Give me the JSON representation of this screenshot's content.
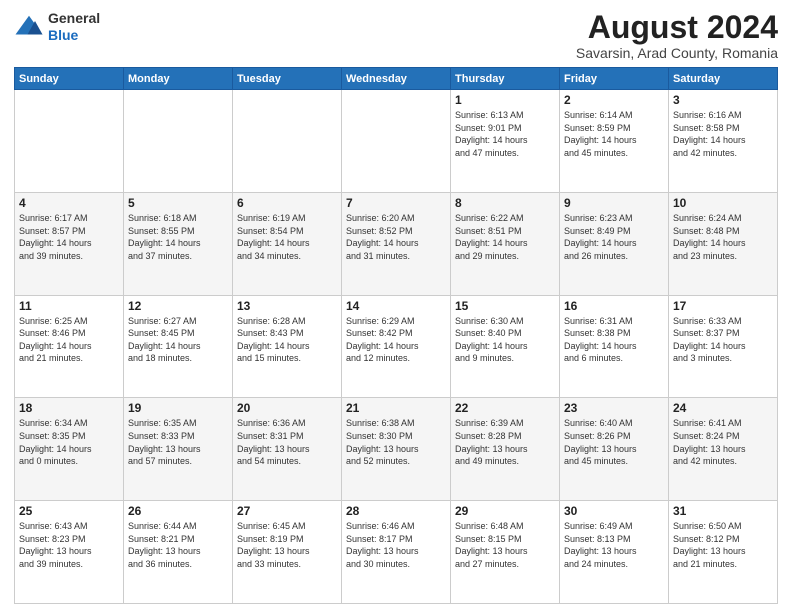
{
  "header": {
    "logo": {
      "line1": "General",
      "line2": "Blue"
    },
    "title": "August 2024",
    "location": "Savarsin, Arad County, Romania"
  },
  "weekdays": [
    "Sunday",
    "Monday",
    "Tuesday",
    "Wednesday",
    "Thursday",
    "Friday",
    "Saturday"
  ],
  "weeks": [
    [
      {
        "day": "",
        "info": ""
      },
      {
        "day": "",
        "info": ""
      },
      {
        "day": "",
        "info": ""
      },
      {
        "day": "",
        "info": ""
      },
      {
        "day": "1",
        "info": "Sunrise: 6:13 AM\nSunset: 9:01 PM\nDaylight: 14 hours\nand 47 minutes."
      },
      {
        "day": "2",
        "info": "Sunrise: 6:14 AM\nSunset: 8:59 PM\nDaylight: 14 hours\nand 45 minutes."
      },
      {
        "day": "3",
        "info": "Sunrise: 6:16 AM\nSunset: 8:58 PM\nDaylight: 14 hours\nand 42 minutes."
      }
    ],
    [
      {
        "day": "4",
        "info": "Sunrise: 6:17 AM\nSunset: 8:57 PM\nDaylight: 14 hours\nand 39 minutes."
      },
      {
        "day": "5",
        "info": "Sunrise: 6:18 AM\nSunset: 8:55 PM\nDaylight: 14 hours\nand 37 minutes."
      },
      {
        "day": "6",
        "info": "Sunrise: 6:19 AM\nSunset: 8:54 PM\nDaylight: 14 hours\nand 34 minutes."
      },
      {
        "day": "7",
        "info": "Sunrise: 6:20 AM\nSunset: 8:52 PM\nDaylight: 14 hours\nand 31 minutes."
      },
      {
        "day": "8",
        "info": "Sunrise: 6:22 AM\nSunset: 8:51 PM\nDaylight: 14 hours\nand 29 minutes."
      },
      {
        "day": "9",
        "info": "Sunrise: 6:23 AM\nSunset: 8:49 PM\nDaylight: 14 hours\nand 26 minutes."
      },
      {
        "day": "10",
        "info": "Sunrise: 6:24 AM\nSunset: 8:48 PM\nDaylight: 14 hours\nand 23 minutes."
      }
    ],
    [
      {
        "day": "11",
        "info": "Sunrise: 6:25 AM\nSunset: 8:46 PM\nDaylight: 14 hours\nand 21 minutes."
      },
      {
        "day": "12",
        "info": "Sunrise: 6:27 AM\nSunset: 8:45 PM\nDaylight: 14 hours\nand 18 minutes."
      },
      {
        "day": "13",
        "info": "Sunrise: 6:28 AM\nSunset: 8:43 PM\nDaylight: 14 hours\nand 15 minutes."
      },
      {
        "day": "14",
        "info": "Sunrise: 6:29 AM\nSunset: 8:42 PM\nDaylight: 14 hours\nand 12 minutes."
      },
      {
        "day": "15",
        "info": "Sunrise: 6:30 AM\nSunset: 8:40 PM\nDaylight: 14 hours\nand 9 minutes."
      },
      {
        "day": "16",
        "info": "Sunrise: 6:31 AM\nSunset: 8:38 PM\nDaylight: 14 hours\nand 6 minutes."
      },
      {
        "day": "17",
        "info": "Sunrise: 6:33 AM\nSunset: 8:37 PM\nDaylight: 14 hours\nand 3 minutes."
      }
    ],
    [
      {
        "day": "18",
        "info": "Sunrise: 6:34 AM\nSunset: 8:35 PM\nDaylight: 14 hours\nand 0 minutes."
      },
      {
        "day": "19",
        "info": "Sunrise: 6:35 AM\nSunset: 8:33 PM\nDaylight: 13 hours\nand 57 minutes."
      },
      {
        "day": "20",
        "info": "Sunrise: 6:36 AM\nSunset: 8:31 PM\nDaylight: 13 hours\nand 54 minutes."
      },
      {
        "day": "21",
        "info": "Sunrise: 6:38 AM\nSunset: 8:30 PM\nDaylight: 13 hours\nand 52 minutes."
      },
      {
        "day": "22",
        "info": "Sunrise: 6:39 AM\nSunset: 8:28 PM\nDaylight: 13 hours\nand 49 minutes."
      },
      {
        "day": "23",
        "info": "Sunrise: 6:40 AM\nSunset: 8:26 PM\nDaylight: 13 hours\nand 45 minutes."
      },
      {
        "day": "24",
        "info": "Sunrise: 6:41 AM\nSunset: 8:24 PM\nDaylight: 13 hours\nand 42 minutes."
      }
    ],
    [
      {
        "day": "25",
        "info": "Sunrise: 6:43 AM\nSunset: 8:23 PM\nDaylight: 13 hours\nand 39 minutes."
      },
      {
        "day": "26",
        "info": "Sunrise: 6:44 AM\nSunset: 8:21 PM\nDaylight: 13 hours\nand 36 minutes."
      },
      {
        "day": "27",
        "info": "Sunrise: 6:45 AM\nSunset: 8:19 PM\nDaylight: 13 hours\nand 33 minutes."
      },
      {
        "day": "28",
        "info": "Sunrise: 6:46 AM\nSunset: 8:17 PM\nDaylight: 13 hours\nand 30 minutes."
      },
      {
        "day": "29",
        "info": "Sunrise: 6:48 AM\nSunset: 8:15 PM\nDaylight: 13 hours\nand 27 minutes."
      },
      {
        "day": "30",
        "info": "Sunrise: 6:49 AM\nSunset: 8:13 PM\nDaylight: 13 hours\nand 24 minutes."
      },
      {
        "day": "31",
        "info": "Sunrise: 6:50 AM\nSunset: 8:12 PM\nDaylight: 13 hours\nand 21 minutes."
      }
    ]
  ]
}
